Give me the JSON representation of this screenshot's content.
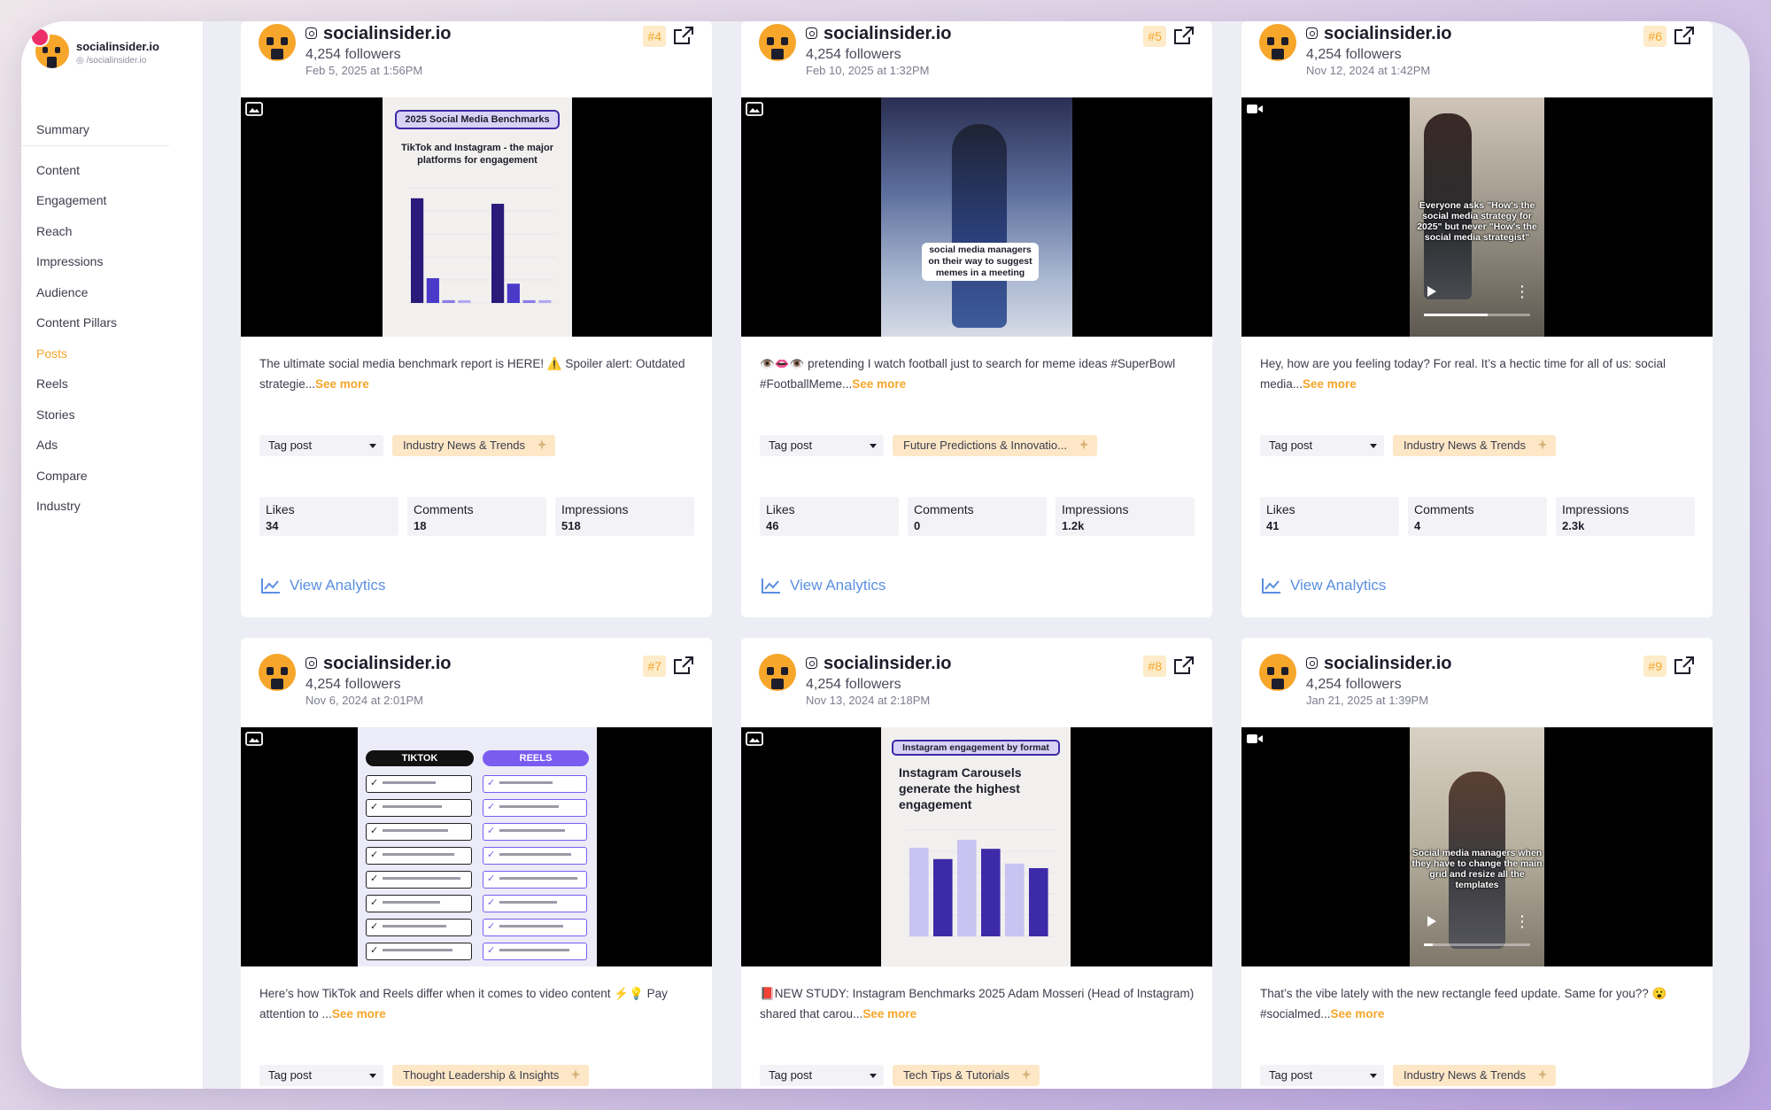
{
  "sidebar": {
    "brand_name": "socialinsider.io",
    "brand_handle": "/socialinsider.io",
    "items": [
      "Summary",
      "Content",
      "Engagement",
      "Reach",
      "Impressions",
      "Audience",
      "Content Pillars",
      "Posts",
      "Reels",
      "Stories",
      "Ads",
      "Compare",
      "Industry"
    ],
    "active": "Posts"
  },
  "common": {
    "account": "socialinsider.io",
    "followers": "4,254 followers",
    "tag_placeholder": "Tag post",
    "view_analytics": "View Analytics",
    "see_more": "See more",
    "likes_label": "Likes",
    "comments_label": "Comments",
    "impressions_label": "Impressions"
  },
  "posts": [
    {
      "rank": "#4",
      "date": "Feb 5, 2025 at 1:56PM",
      "caption": "The ultimate social media benchmark report is HERE! ⚠️ Spoiler alert: Outdated strategie...",
      "tag": "Industry News & Trends",
      "likes": "34",
      "comments": "18",
      "impressions": "518",
      "media": "image",
      "thumb": {
        "title": "2025 Social Media Benchmarks",
        "subtitle": "TikTok and Instagram - the major platforms for engagement",
        "chart_values": [
          3.8,
          0.9,
          0.1,
          0.1,
          3.6,
          0.7,
          0.1,
          0.1
        ]
      }
    },
    {
      "rank": "#5",
      "date": "Feb 10, 2025 at 1:32PM",
      "caption": "👁️👄👁️ pretending I watch football just to search for meme ideas #SuperBowl #FootballMeme...",
      "tag": "Future Predictions & Innovatio...",
      "likes": "46",
      "comments": "0",
      "impressions": "1.2k",
      "media": "image",
      "thumb": {
        "overlay": "social media managers on their way to suggest memes in a meeting"
      }
    },
    {
      "rank": "#6",
      "date": "Nov 12, 2024 at 1:42PM",
      "caption": "Hey, how are you feeling today? For real. It’s a hectic time for all of us: social media...",
      "tag": "Industry News & Trends",
      "likes": "41",
      "comments": "4",
      "impressions": "2.3k",
      "media": "video",
      "thumb": {
        "overlay": "Everyone asks \"How's the social media strategy for 2025\" but never \"How's the social media strategist\""
      }
    },
    {
      "rank": "#7",
      "date": "Nov 6, 2024 at 2:01PM",
      "caption": "Here’s how TikTok and Reels differ when it comes to video content ⚡💡 Pay attention to ...",
      "tag": "Thought Leadership & Insights",
      "media": "image",
      "thumb": {
        "left": "TIKTOK",
        "right": "REELS",
        "rows": 8
      }
    },
    {
      "rank": "#8",
      "date": "Nov 13, 2024 at 2:18PM",
      "caption": "📕NEW STUDY: Instagram Benchmarks 2025 Adam Mosseri (Head of Instagram) shared that carou...",
      "tag": "Tech Tips & Tutorials",
      "media": "image",
      "thumb": {
        "title": "Instagram engagement by format",
        "subtitle": "Instagram Carousels generate the highest engagement",
        "chart_values": [
          0.78,
          0.68,
          0.85,
          0.77,
          0.64,
          0.6
        ]
      }
    },
    {
      "rank": "#9",
      "date": "Jan 21, 2025 at 1:39PM",
      "caption": "That’s the vibe lately with the new rectangle feed update. Same for you?? 😮 #socialmed...",
      "tag": "Industry News & Trends",
      "media": "video",
      "thumb": {
        "overlay": "Social media managers when they have to change the main grid and resize all the templates"
      }
    }
  ],
  "colors": {
    "accent": "#f6a62a",
    "link": "#5b8fe0",
    "bar_dark": "#3d2aa8",
    "bar_light": "#c9c3f2"
  }
}
